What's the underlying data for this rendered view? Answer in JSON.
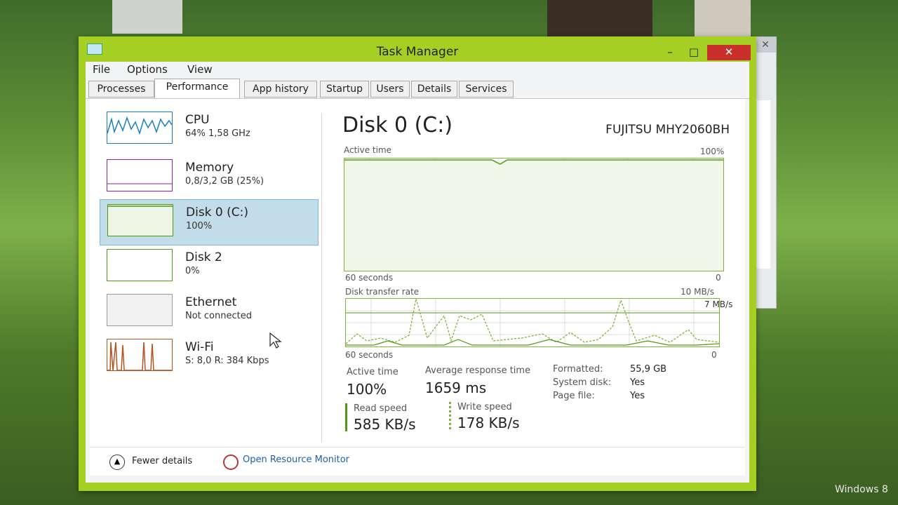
{
  "window": {
    "title": "Task Manager",
    "minimize": "–",
    "maximize": "□",
    "close": "✕",
    "background_close": "✕"
  },
  "menu": {
    "file": "File",
    "options": "Options",
    "view": "View"
  },
  "tabs": [
    "Processes",
    "Performance",
    "App history",
    "Startup",
    "Users",
    "Details",
    "Services"
  ],
  "sidebar": {
    "items": [
      {
        "name": "CPU",
        "value": "64% 1,58 GHz",
        "color": "#1a7fbd"
      },
      {
        "name": "Memory",
        "value": "0,8/3,2 GB (25%)",
        "color": "#8b22a6"
      },
      {
        "name": "Disk 0 (C:)",
        "value": "100%",
        "color": "#4d9a12"
      },
      {
        "name": "Disk 2",
        "value": "0%",
        "color": "#4d9a12"
      },
      {
        "name": "Ethernet",
        "value": "Not connected",
        "color": "#9a9a9a"
      },
      {
        "name": "Wi-Fi",
        "value": "S: 8,0 R: 384 Kbps",
        "color": "#b3541e"
      }
    ]
  },
  "main": {
    "title": "Disk 0 (C:)",
    "model": "FUJITSU MHY2060BH",
    "active_time_graph": {
      "label": "Active time",
      "max": "100%",
      "time_span": "60 seconds",
      "min": "0"
    },
    "transfer_graph": {
      "label": "Disk transfer rate",
      "max": "10 MB/s",
      "mid": "7 MB/s",
      "time_span": "60 seconds",
      "min": "0"
    },
    "stats": {
      "active_time_label": "Active time",
      "active_time": "100%",
      "response_label": "Average response time",
      "response": "1659 ms",
      "read_label": "Read speed",
      "read": "585 KB/s",
      "write_label": "Write speed",
      "write": "178 KB/s"
    },
    "properties": [
      {
        "label": "Formatted:",
        "value": "55,9 GB"
      },
      {
        "label": "System disk:",
        "value": "Yes"
      },
      {
        "label": "Page file:",
        "value": "Yes"
      }
    ]
  },
  "footer": {
    "fewer_details": "Fewer details",
    "resource_monitor": "Open Resource Monitor"
  },
  "desktop": {
    "watermark": "Windows 8"
  },
  "colors": {
    "accent": "#a6cf23",
    "disk_line": "#7fb23a",
    "selected": "#c3dcea"
  }
}
